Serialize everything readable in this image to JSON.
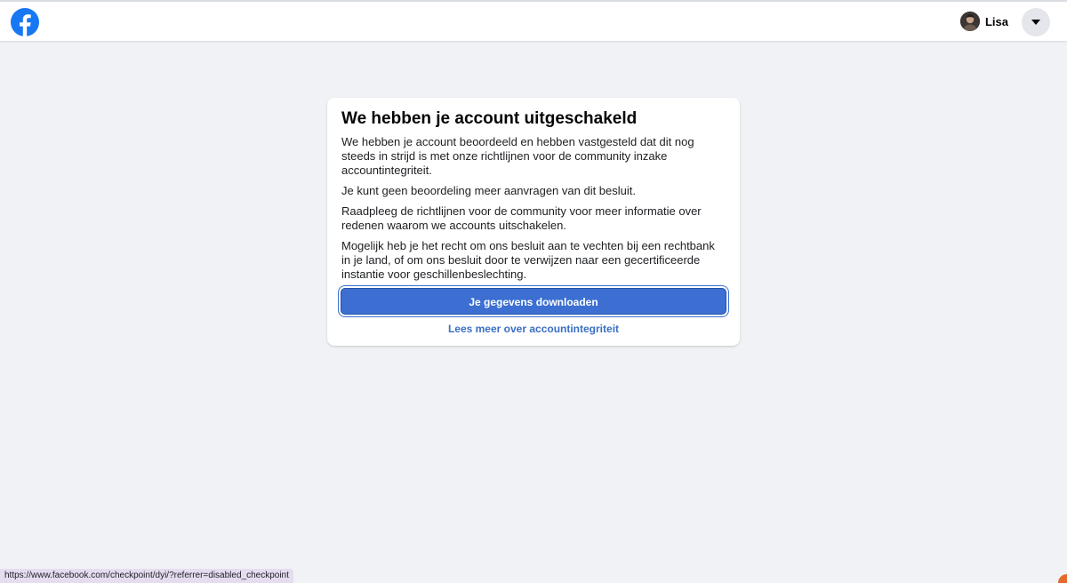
{
  "header": {
    "profile_name": "Lisa",
    "logo_icon": "facebook-logo-icon",
    "menu_icon": "caret-down-icon",
    "brand_color": "#1877f2"
  },
  "card": {
    "title": "We hebben je account uitgeschakeld",
    "paragraphs": [
      "We hebben je account beoordeeld en hebben vastgesteld dat dit nog steeds in strijd is met onze richtlijnen voor de community inzake accountintegriteit.",
      "Je kunt geen beoordeling meer aanvragen van dit besluit.",
      "Raadpleeg de richtlijnen voor de community voor meer informatie over redenen waarom we accounts uitschakelen.",
      "Mogelijk heb je het recht om ons besluit aan te vechten bij een rechtbank in je land, of om ons besluit door te verwijzen naar een gecertificeerde instantie voor geschillenbeslechting."
    ],
    "download_button_label": "Je gegevens downloaden",
    "learn_more_link": "Lees meer over accountintegriteit",
    "button_color": "#3c6fd1"
  },
  "status_bar": {
    "url": "https://www.facebook.com/checkpoint/dyi/?referrer=disabled_checkpoint"
  }
}
